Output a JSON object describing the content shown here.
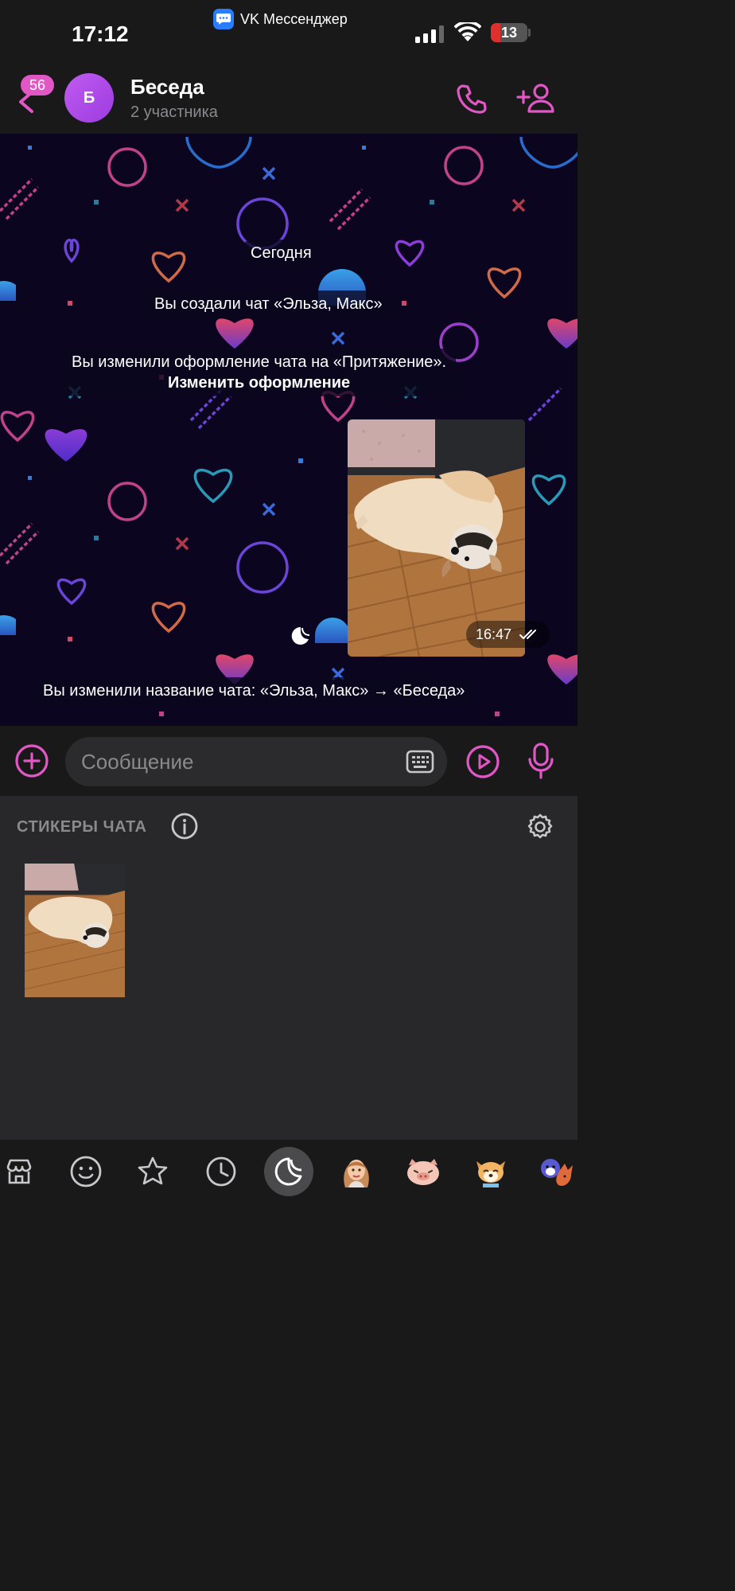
{
  "status_bar": {
    "time": "17:12",
    "app_name": "VK Мессенджер",
    "battery": "13"
  },
  "header": {
    "unread_badge": "56",
    "avatar_letter": "Б",
    "title": "Беседа",
    "subtitle": "2 участника"
  },
  "chat": {
    "date_label": "Сегодня",
    "service_created": "Вы создали чат «Эльза, Макс»",
    "service_theme": "Вы изменили оформление чата на «Притяжение».",
    "service_theme_link": "Изменить оформление",
    "photo_time": "16:47",
    "service_renamed": "Вы изменили название чата: «Эльза, Макс» → «Беседа»"
  },
  "input": {
    "placeholder": "Сообщение"
  },
  "sticker_panel": {
    "title": "СТИКЕРЫ ЧАТА"
  },
  "tabs": [
    "store-icon",
    "emoji-icon",
    "favorites-icon",
    "recent-icon",
    "chat-stickers-icon",
    "avatar-sticker-icon",
    "pig-sticker-icon",
    "dog-sticker-icon",
    "animals-sticker-icon"
  ],
  "colors": {
    "accent": "#e157c5",
    "background": "#19191a",
    "panel": "#28282a",
    "chat_bg": "#0b0520"
  }
}
